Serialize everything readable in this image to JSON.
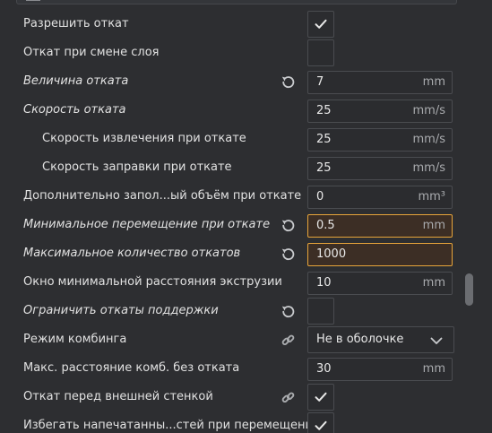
{
  "settings": [
    {
      "label": "Разрешить откат",
      "italic": false,
      "sub": false,
      "control": "checkbox",
      "checked": true,
      "icon": null
    },
    {
      "label": "Откат при смене слоя",
      "italic": false,
      "sub": false,
      "control": "checkbox",
      "checked": false,
      "icon": null
    },
    {
      "label": "Величина отката",
      "italic": true,
      "sub": false,
      "control": "field",
      "value": "7",
      "unit": "mm",
      "icon": "reset-icon"
    },
    {
      "label": "Скорость отката",
      "italic": true,
      "sub": false,
      "control": "field",
      "value": "25",
      "unit": "mm/s",
      "icon": null
    },
    {
      "label": "Скорость извлечения при откате",
      "italic": false,
      "sub": true,
      "control": "field",
      "value": "25",
      "unit": "mm/s",
      "icon": null
    },
    {
      "label": "Скорость заправки при откате",
      "italic": false,
      "sub": true,
      "control": "field",
      "value": "25",
      "unit": "mm/s",
      "icon": null
    },
    {
      "label": "Дополнительно запол...ый объём при откате",
      "italic": false,
      "sub": false,
      "control": "field",
      "value": "0",
      "unit": "mm³",
      "icon": null
    },
    {
      "label": "Минимальное перемещение при откате",
      "italic": true,
      "sub": false,
      "control": "field",
      "value": "0.5",
      "unit": "mm",
      "icon": "reset-icon",
      "highlight": true
    },
    {
      "label": "Максимальное количество откатов",
      "italic": true,
      "sub": false,
      "control": "field",
      "value": "1000",
      "unit": "",
      "icon": "reset-icon",
      "highlight": true
    },
    {
      "label": "Окно минимальной расстояния экструзии",
      "italic": false,
      "sub": false,
      "control": "field",
      "value": "10",
      "unit": "mm",
      "icon": null
    },
    {
      "label": "Ограничить откаты поддержки",
      "italic": true,
      "sub": false,
      "control": "checkbox",
      "checked": false,
      "icon": "reset-icon"
    },
    {
      "label": "Режим комбинга",
      "italic": false,
      "sub": false,
      "control": "select",
      "value": "Не в оболочке",
      "icon": "link-icon"
    },
    {
      "label": "Макс. расстояние комб. без отката",
      "italic": false,
      "sub": false,
      "control": "field",
      "value": "30",
      "unit": "mm",
      "icon": null
    },
    {
      "label": "Откат перед внешней стенкой",
      "italic": false,
      "sub": false,
      "control": "checkbox",
      "checked": true,
      "icon": "link-icon"
    },
    {
      "label": "Избегать напечатанны...стей при перемещении",
      "italic": false,
      "sub": false,
      "control": "checkbox",
      "checked": true,
      "icon": null
    }
  ],
  "colors": {
    "background": "#2d2e31",
    "field_background": "#2b2c2f",
    "field_border": "#4a4c50",
    "highlight_border": "#e7a43a",
    "highlight_background": "#3c2e25",
    "text": "#e1e1e1",
    "unit_text": "#a9abae"
  }
}
